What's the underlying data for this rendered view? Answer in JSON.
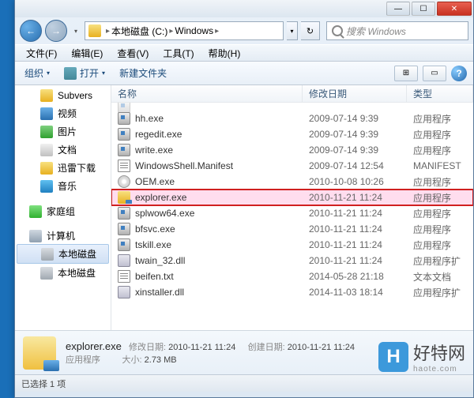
{
  "titlebar": {
    "min": "—",
    "max": "☐",
    "close": "✕"
  },
  "breadcrumb": {
    "drive": "本地磁盘 (C:)",
    "folder": "Windows",
    "back": "←",
    "fwd": "→",
    "drop": "▾",
    "refresh": "↻",
    "sep": "▸"
  },
  "search": {
    "placeholder": "搜索 Windows"
  },
  "menu": {
    "file": "文件(F)",
    "edit": "编辑(E)",
    "view": "查看(V)",
    "tools": "工具(T)",
    "help": "帮助(H)"
  },
  "toolbar": {
    "organize": "组织",
    "open": "打开",
    "newfolder": "新建文件夹",
    "drop": "▾",
    "view_icon": "⊞",
    "preview_icon": "▭",
    "help": "?"
  },
  "columns": {
    "name": "名称",
    "date": "修改日期",
    "type": "类型"
  },
  "sidebar": {
    "items": [
      {
        "label": "Subvers",
        "icon": "ico-folder",
        "indent": true
      },
      {
        "label": "视频",
        "icon": "ico-video",
        "indent": true
      },
      {
        "label": "图片",
        "icon": "ico-image",
        "indent": true
      },
      {
        "label": "文档",
        "icon": "ico-doc",
        "indent": true
      },
      {
        "label": "迅雷下载",
        "icon": "ico-folder",
        "indent": true
      },
      {
        "label": "音乐",
        "icon": "ico-music",
        "indent": true
      }
    ],
    "homegroup": "家庭组",
    "computer": "计算机",
    "drive": "本地磁盘"
  },
  "files": [
    {
      "name": "hh.exe",
      "date": "2009-07-14 9:39",
      "type": "应用程序",
      "icon": "fico-exe"
    },
    {
      "name": "regedit.exe",
      "date": "2009-07-14 9:39",
      "type": "应用程序",
      "icon": "fico-exe"
    },
    {
      "name": "write.exe",
      "date": "2009-07-14 9:39",
      "type": "应用程序",
      "icon": "fico-exe"
    },
    {
      "name": "WindowsShell.Manifest",
      "date": "2009-07-14 12:54",
      "type": "MANIFEST",
      "icon": "fico-txt"
    },
    {
      "name": "OEM.exe",
      "date": "2010-10-08 10:26",
      "type": "应用程序",
      "icon": "fico-cd"
    },
    {
      "name": "explorer.exe",
      "date": "2010-11-21 11:24",
      "type": "应用程序",
      "icon": "fico-explorer",
      "highlight": true
    },
    {
      "name": "splwow64.exe",
      "date": "2010-11-21 11:24",
      "type": "应用程序",
      "icon": "fico-exe"
    },
    {
      "name": "bfsvc.exe",
      "date": "2010-11-21 11:24",
      "type": "应用程序",
      "icon": "fico-exe"
    },
    {
      "name": "tskill.exe",
      "date": "2010-11-21 11:24",
      "type": "应用程序",
      "icon": "fico-exe"
    },
    {
      "name": "twain_32.dll",
      "date": "2010-11-21 11:24",
      "type": "应用程序扩",
      "icon": "fico-dll"
    },
    {
      "name": "beifen.txt",
      "date": "2014-05-28 21:18",
      "type": "文本文档",
      "icon": "fico-txt"
    },
    {
      "name": "xinstaller.dll",
      "date": "2014-11-03 18:14",
      "type": "应用程序扩",
      "icon": "fico-dll"
    }
  ],
  "details": {
    "name": "explorer.exe",
    "mod_label": "修改日期:",
    "mod_value": "2010-11-21 11:24",
    "create_label": "创建日期:",
    "create_value": "2010-11-21 11:24",
    "type_label": "应用程序",
    "size_label": "大小:",
    "size_value": "2.73 MB"
  },
  "status": {
    "text": "已选择 1 项"
  },
  "watermark": {
    "logo": "H",
    "text": "好特网",
    "sub": "haote.com"
  }
}
